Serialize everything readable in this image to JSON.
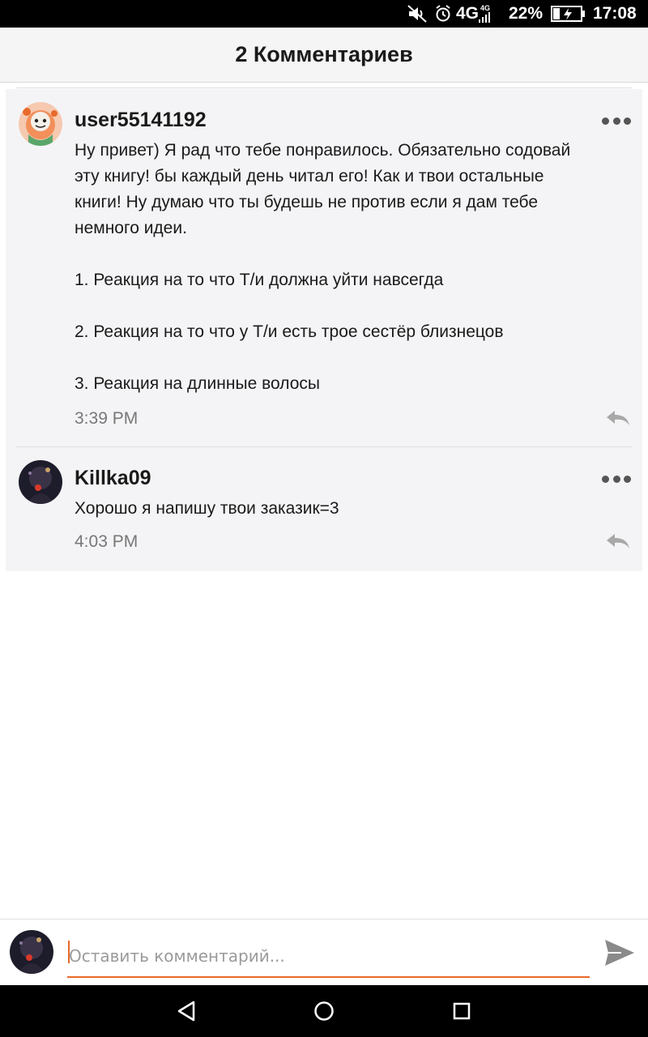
{
  "status_bar": {
    "network": "4G",
    "network_small": "4G",
    "battery_percent": "22%",
    "time": "17:08",
    "icons": [
      "mute-icon",
      "alarm-icon",
      "signal-icon",
      "battery-charging-icon"
    ]
  },
  "header": {
    "title": "2 Комментариев"
  },
  "comments": [
    {
      "username": "user55141192",
      "lines": [
        "Ну привет) Я рад что тебе понравилось. Обязательно содовай",
        "эту книгу! бы каждый день читал его! Как и твои остальные",
        "книги! Ну думаю что ты будешь не против если я дам тебе",
        "немного идеи.",
        "",
        "1. Реакция на то что Т/и должна уйти навсегда",
        "",
        "2. Реакция на то что у Т/и есть трое сестёр близнецов",
        "",
        "3. Реакция на длинные волосы"
      ],
      "time": "3:39 PM"
    },
    {
      "username": "Killka09",
      "lines": [
        "Хорошо я напишу твои заказик=3"
      ],
      "time": "4:03 PM"
    }
  ],
  "compose": {
    "placeholder": "Оставить комментарий..."
  },
  "colors": {
    "accent": "#e8692a",
    "panel_bg": "#f4f4f6",
    "header_bg": "#f5f5f5"
  }
}
